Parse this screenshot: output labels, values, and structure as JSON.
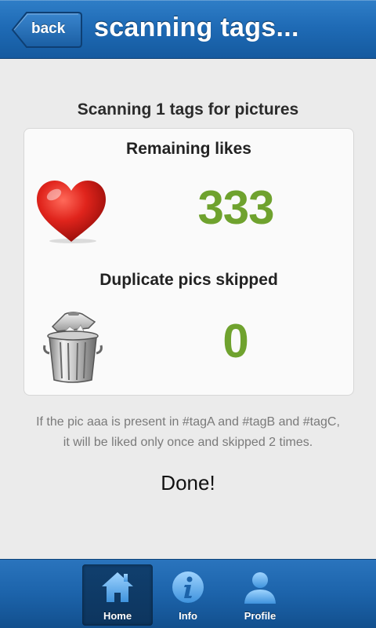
{
  "header": {
    "back_label": "back",
    "title": "scanning tags..."
  },
  "main": {
    "scan_status": "Scanning 1 tags for pictures",
    "likes": {
      "label": "Remaining likes",
      "value": "333",
      "icon": "heart-icon"
    },
    "duplicates": {
      "label": "Duplicate pics skipped",
      "value": "0",
      "icon": "trash-can-icon"
    },
    "info": "If the pic aaa is present in #tagA and #tagB and #tagC, it will be liked only once and skipped 2 times.",
    "done": "Done!"
  },
  "footer": {
    "tabs": [
      {
        "label": "Home",
        "icon": "home-icon",
        "active": true
      },
      {
        "label": "Info",
        "icon": "info-icon",
        "active": false
      },
      {
        "label": "Profile",
        "icon": "profile-icon",
        "active": false
      }
    ]
  },
  "colors": {
    "header_blue": "#1f6bb6",
    "count_green": "#6fa22e",
    "background": "#ebebeb"
  }
}
